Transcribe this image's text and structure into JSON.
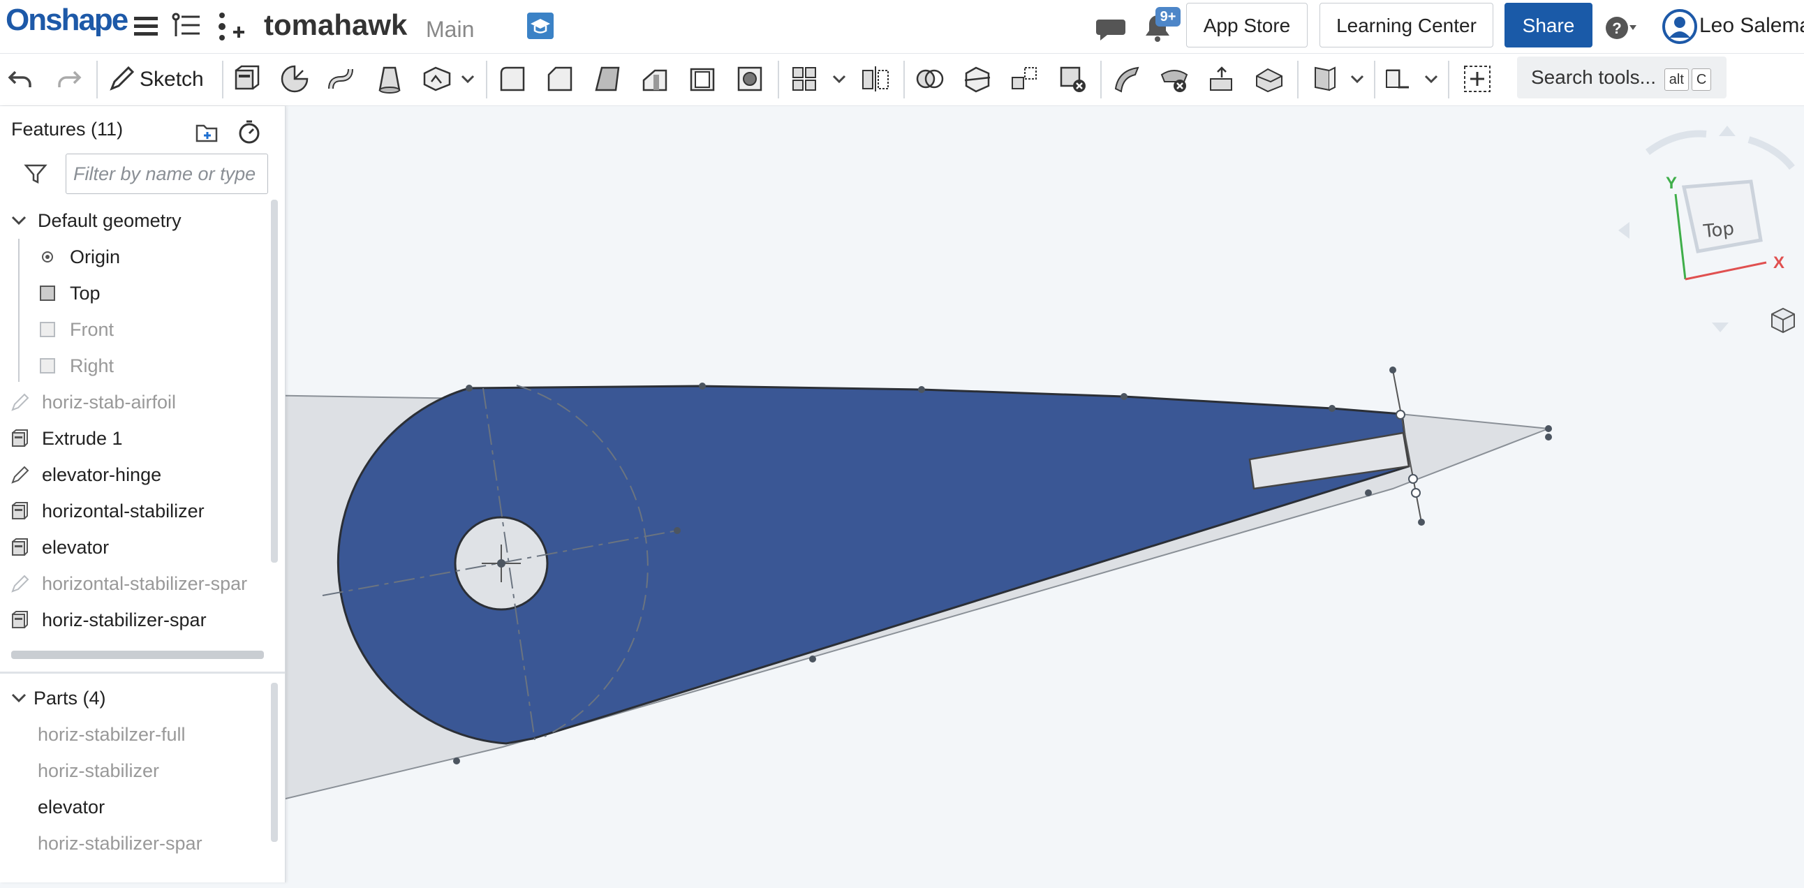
{
  "app": {
    "logo": "Onshape",
    "document_title": "tomahawk",
    "branch": "Main"
  },
  "header": {
    "notifications_badge": "9+",
    "app_store_label": "App Store",
    "learning_center_label": "Learning Center",
    "share_label": "Share",
    "user_name": "Leo Salemann"
  },
  "toolbar": {
    "sketch_label": "Sketch",
    "search_label": "Search tools...",
    "search_kbd_1": "alt",
    "search_kbd_2": "C"
  },
  "feature_panel": {
    "title": "Features (11)",
    "filter_placeholder": "Filter by name or type",
    "default_geometry_label": "Default geometry",
    "geometry_items": [
      {
        "label": "Origin",
        "dimmed": false,
        "icon": "origin-icon"
      },
      {
        "label": "Top",
        "dimmed": false,
        "icon": "plane-icon"
      },
      {
        "label": "Front",
        "dimmed": true,
        "icon": "plane-icon"
      },
      {
        "label": "Right",
        "dimmed": true,
        "icon": "plane-icon"
      }
    ],
    "features": [
      {
        "label": "horiz-stab-airfoil",
        "dimmed": true,
        "icon": "sketch-icon"
      },
      {
        "label": "Extrude 1",
        "dimmed": false,
        "icon": "extrude-icon"
      },
      {
        "label": "elevator-hinge",
        "dimmed": false,
        "icon": "sketch-icon"
      },
      {
        "label": "horizontal-stabilizer",
        "dimmed": false,
        "icon": "extrude-icon"
      },
      {
        "label": "elevator",
        "dimmed": false,
        "icon": "extrude-icon"
      },
      {
        "label": "horizontal-stabilizer-spar",
        "dimmed": true,
        "icon": "sketch-icon"
      },
      {
        "label": "horiz-stabilizer-spar",
        "dimmed": false,
        "icon": "extrude-icon"
      }
    ],
    "parts_label": "Parts (4)",
    "parts": [
      {
        "label": "horiz-stabilzer-full",
        "dimmed": true
      },
      {
        "label": "horiz-stabilizer",
        "dimmed": true
      },
      {
        "label": "elevator",
        "dimmed": false
      },
      {
        "label": "horiz-stabilizer-spar",
        "dimmed": true
      }
    ]
  },
  "view_cube": {
    "face_label": "Top",
    "x_axis": "X",
    "y_axis": "Y"
  },
  "colors": {
    "brand": "#1d59a8",
    "share_button": "#1a5aa8",
    "part_selected": "#3a5795",
    "part_unselected": "#dde0e4",
    "canvas": "#f3f6f9"
  }
}
